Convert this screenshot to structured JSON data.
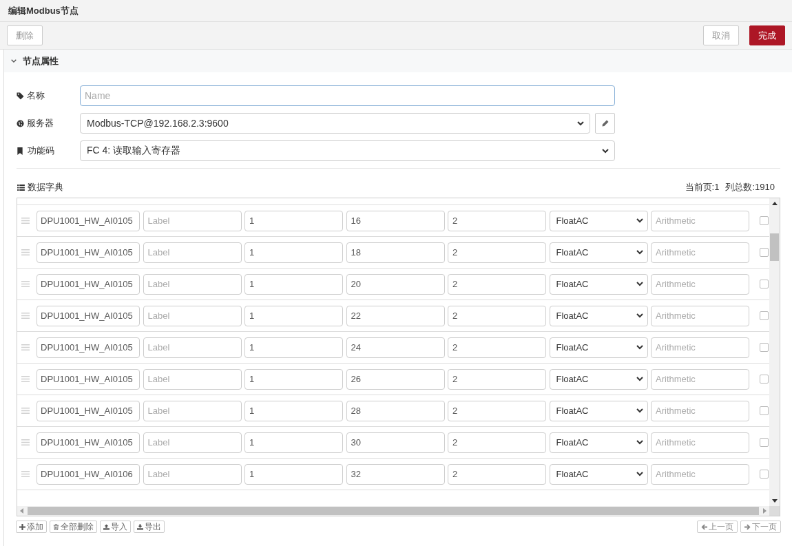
{
  "window": {
    "title": "编辑Modbus节点"
  },
  "toolbar": {
    "left_buttons": [
      {
        "label": "删除",
        "kind": "secondary"
      }
    ],
    "right_buttons": [
      {
        "label": "取消",
        "kind": "secondary"
      },
      {
        "label": "完成",
        "kind": "primary"
      }
    ]
  },
  "section": {
    "title": "节点属性",
    "expanded": true
  },
  "form": [
    {
      "kind": "text",
      "label": "名称",
      "placeholder": "Name",
      "focused": true,
      "edit_button": false
    },
    {
      "kind": "select",
      "label": "服务器",
      "value": "Modbus-TCP@192.168.2.3:9600",
      "focused": false,
      "edit_button": true
    },
    {
      "kind": "select",
      "label": "功能码",
      "value": "FC 4: 读取输入寄存器",
      "focused": false,
      "edit_button": false
    }
  ],
  "dictionary": {
    "title": "数据字典",
    "current_page": "当前页:1",
    "total_count": "列总数:1910",
    "rows": [
      {
        "fields": [
          {
            "kind": "input",
            "value": "DPU1001_HW_AI0105"
          },
          {
            "kind": "input",
            "placeholder": "Label"
          },
          {
            "kind": "input",
            "value": "1"
          },
          {
            "kind": "input",
            "value": "16"
          },
          {
            "kind": "input",
            "value": "2"
          },
          {
            "kind": "select",
            "value": "FloatAC"
          },
          {
            "kind": "input",
            "placeholder": "Arithmetic"
          }
        ],
        "checked": false
      },
      {
        "fields": [
          {
            "kind": "input",
            "value": "DPU1001_HW_AI0105"
          },
          {
            "kind": "input",
            "placeholder": "Label"
          },
          {
            "kind": "input",
            "value": "1"
          },
          {
            "kind": "input",
            "value": "18"
          },
          {
            "kind": "input",
            "value": "2"
          },
          {
            "kind": "select",
            "value": "FloatAC"
          },
          {
            "kind": "input",
            "placeholder": "Arithmetic"
          }
        ],
        "checked": false
      },
      {
        "fields": [
          {
            "kind": "input",
            "value": "DPU1001_HW_AI0105"
          },
          {
            "kind": "input",
            "placeholder": "Label"
          },
          {
            "kind": "input",
            "value": "1"
          },
          {
            "kind": "input",
            "value": "20"
          },
          {
            "kind": "input",
            "value": "2"
          },
          {
            "kind": "select",
            "value": "FloatAC"
          },
          {
            "kind": "input",
            "placeholder": "Arithmetic"
          }
        ],
        "checked": false
      },
      {
        "fields": [
          {
            "kind": "input",
            "value": "DPU1001_HW_AI0105"
          },
          {
            "kind": "input",
            "placeholder": "Label"
          },
          {
            "kind": "input",
            "value": "1"
          },
          {
            "kind": "input",
            "value": "22"
          },
          {
            "kind": "input",
            "value": "2"
          },
          {
            "kind": "select",
            "value": "FloatAC"
          },
          {
            "kind": "input",
            "placeholder": "Arithmetic"
          }
        ],
        "checked": false
      },
      {
        "fields": [
          {
            "kind": "input",
            "value": "DPU1001_HW_AI0105"
          },
          {
            "kind": "input",
            "placeholder": "Label"
          },
          {
            "kind": "input",
            "value": "1"
          },
          {
            "kind": "input",
            "value": "24"
          },
          {
            "kind": "input",
            "value": "2"
          },
          {
            "kind": "select",
            "value": "FloatAC"
          },
          {
            "kind": "input",
            "placeholder": "Arithmetic"
          }
        ],
        "checked": false
      },
      {
        "fields": [
          {
            "kind": "input",
            "value": "DPU1001_HW_AI0105"
          },
          {
            "kind": "input",
            "placeholder": "Label"
          },
          {
            "kind": "input",
            "value": "1"
          },
          {
            "kind": "input",
            "value": "26"
          },
          {
            "kind": "input",
            "value": "2"
          },
          {
            "kind": "select",
            "value": "FloatAC"
          },
          {
            "kind": "input",
            "placeholder": "Arithmetic"
          }
        ],
        "checked": false
      },
      {
        "fields": [
          {
            "kind": "input",
            "value": "DPU1001_HW_AI0105"
          },
          {
            "kind": "input",
            "placeholder": "Label"
          },
          {
            "kind": "input",
            "value": "1"
          },
          {
            "kind": "input",
            "value": "28"
          },
          {
            "kind": "input",
            "value": "2"
          },
          {
            "kind": "select",
            "value": "FloatAC"
          },
          {
            "kind": "input",
            "placeholder": "Arithmetic"
          }
        ],
        "checked": false
      },
      {
        "fields": [
          {
            "kind": "input",
            "value": "DPU1001_HW_AI0105"
          },
          {
            "kind": "input",
            "placeholder": "Label"
          },
          {
            "kind": "input",
            "value": "1"
          },
          {
            "kind": "input",
            "value": "30"
          },
          {
            "kind": "input",
            "value": "2"
          },
          {
            "kind": "select",
            "value": "FloatAC"
          },
          {
            "kind": "input",
            "placeholder": "Arithmetic"
          }
        ],
        "checked": false
      },
      {
        "fields": [
          {
            "kind": "input",
            "value": "DPU1001_HW_AI0106"
          },
          {
            "kind": "input",
            "placeholder": "Label"
          },
          {
            "kind": "input",
            "value": "1"
          },
          {
            "kind": "input",
            "value": "32"
          },
          {
            "kind": "input",
            "value": "2"
          },
          {
            "kind": "select",
            "value": "FloatAC"
          },
          {
            "kind": "input",
            "placeholder": "Arithmetic"
          }
        ],
        "checked": false
      }
    ]
  },
  "footer": {
    "buttons": [
      {
        "label": "添加"
      },
      {
        "label": "全部删除"
      },
      {
        "label": "导入"
      },
      {
        "label": "导出"
      }
    ],
    "pager": [
      {
        "label": "上一页"
      },
      {
        "label": "下一页"
      }
    ]
  }
}
